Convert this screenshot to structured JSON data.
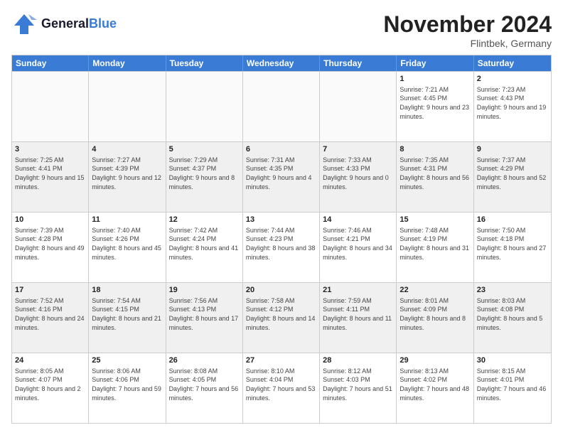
{
  "header": {
    "logo_general": "General",
    "logo_blue": "Blue",
    "month_title": "November 2024",
    "location": "Flintbek, Germany"
  },
  "weekdays": [
    "Sunday",
    "Monday",
    "Tuesday",
    "Wednesday",
    "Thursday",
    "Friday",
    "Saturday"
  ],
  "rows": [
    [
      {
        "day": "",
        "info": ""
      },
      {
        "day": "",
        "info": ""
      },
      {
        "day": "",
        "info": ""
      },
      {
        "day": "",
        "info": ""
      },
      {
        "day": "",
        "info": ""
      },
      {
        "day": "1",
        "info": "Sunrise: 7:21 AM\nSunset: 4:45 PM\nDaylight: 9 hours and 23 minutes."
      },
      {
        "day": "2",
        "info": "Sunrise: 7:23 AM\nSunset: 4:43 PM\nDaylight: 9 hours and 19 minutes."
      }
    ],
    [
      {
        "day": "3",
        "info": "Sunrise: 7:25 AM\nSunset: 4:41 PM\nDaylight: 9 hours and 15 minutes."
      },
      {
        "day": "4",
        "info": "Sunrise: 7:27 AM\nSunset: 4:39 PM\nDaylight: 9 hours and 12 minutes."
      },
      {
        "day": "5",
        "info": "Sunrise: 7:29 AM\nSunset: 4:37 PM\nDaylight: 9 hours and 8 minutes."
      },
      {
        "day": "6",
        "info": "Sunrise: 7:31 AM\nSunset: 4:35 PM\nDaylight: 9 hours and 4 minutes."
      },
      {
        "day": "7",
        "info": "Sunrise: 7:33 AM\nSunset: 4:33 PM\nDaylight: 9 hours and 0 minutes."
      },
      {
        "day": "8",
        "info": "Sunrise: 7:35 AM\nSunset: 4:31 PM\nDaylight: 8 hours and 56 minutes."
      },
      {
        "day": "9",
        "info": "Sunrise: 7:37 AM\nSunset: 4:29 PM\nDaylight: 8 hours and 52 minutes."
      }
    ],
    [
      {
        "day": "10",
        "info": "Sunrise: 7:39 AM\nSunset: 4:28 PM\nDaylight: 8 hours and 49 minutes."
      },
      {
        "day": "11",
        "info": "Sunrise: 7:40 AM\nSunset: 4:26 PM\nDaylight: 8 hours and 45 minutes."
      },
      {
        "day": "12",
        "info": "Sunrise: 7:42 AM\nSunset: 4:24 PM\nDaylight: 8 hours and 41 minutes."
      },
      {
        "day": "13",
        "info": "Sunrise: 7:44 AM\nSunset: 4:23 PM\nDaylight: 8 hours and 38 minutes."
      },
      {
        "day": "14",
        "info": "Sunrise: 7:46 AM\nSunset: 4:21 PM\nDaylight: 8 hours and 34 minutes."
      },
      {
        "day": "15",
        "info": "Sunrise: 7:48 AM\nSunset: 4:19 PM\nDaylight: 8 hours and 31 minutes."
      },
      {
        "day": "16",
        "info": "Sunrise: 7:50 AM\nSunset: 4:18 PM\nDaylight: 8 hours and 27 minutes."
      }
    ],
    [
      {
        "day": "17",
        "info": "Sunrise: 7:52 AM\nSunset: 4:16 PM\nDaylight: 8 hours and 24 minutes."
      },
      {
        "day": "18",
        "info": "Sunrise: 7:54 AM\nSunset: 4:15 PM\nDaylight: 8 hours and 21 minutes."
      },
      {
        "day": "19",
        "info": "Sunrise: 7:56 AM\nSunset: 4:13 PM\nDaylight: 8 hours and 17 minutes."
      },
      {
        "day": "20",
        "info": "Sunrise: 7:58 AM\nSunset: 4:12 PM\nDaylight: 8 hours and 14 minutes."
      },
      {
        "day": "21",
        "info": "Sunrise: 7:59 AM\nSunset: 4:11 PM\nDaylight: 8 hours and 11 minutes."
      },
      {
        "day": "22",
        "info": "Sunrise: 8:01 AM\nSunset: 4:09 PM\nDaylight: 8 hours and 8 minutes."
      },
      {
        "day": "23",
        "info": "Sunrise: 8:03 AM\nSunset: 4:08 PM\nDaylight: 8 hours and 5 minutes."
      }
    ],
    [
      {
        "day": "24",
        "info": "Sunrise: 8:05 AM\nSunset: 4:07 PM\nDaylight: 8 hours and 2 minutes."
      },
      {
        "day": "25",
        "info": "Sunrise: 8:06 AM\nSunset: 4:06 PM\nDaylight: 7 hours and 59 minutes."
      },
      {
        "day": "26",
        "info": "Sunrise: 8:08 AM\nSunset: 4:05 PM\nDaylight: 7 hours and 56 minutes."
      },
      {
        "day": "27",
        "info": "Sunrise: 8:10 AM\nSunset: 4:04 PM\nDaylight: 7 hours and 53 minutes."
      },
      {
        "day": "28",
        "info": "Sunrise: 8:12 AM\nSunset: 4:03 PM\nDaylight: 7 hours and 51 minutes."
      },
      {
        "day": "29",
        "info": "Sunrise: 8:13 AM\nSunset: 4:02 PM\nDaylight: 7 hours and 48 minutes."
      },
      {
        "day": "30",
        "info": "Sunrise: 8:15 AM\nSunset: 4:01 PM\nDaylight: 7 hours and 46 minutes."
      }
    ]
  ]
}
